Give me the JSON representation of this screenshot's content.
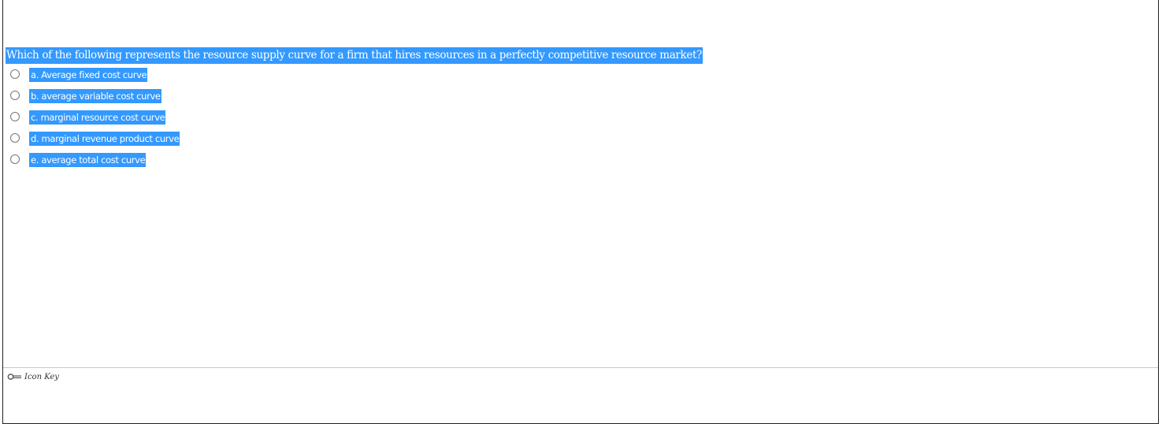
{
  "question": {
    "text": "Which of the following represents the resource supply curve for a firm that hires resources in a perfectly competitive resource market?"
  },
  "options": [
    {
      "label": "a. Average fixed cost curve",
      "selected": false
    },
    {
      "label": "b. average variable cost curve",
      "selected": false
    },
    {
      "label": "c. marginal resource cost curve",
      "selected": false
    },
    {
      "label": "d. marginal revenue product curve",
      "selected": false
    },
    {
      "label": "e. average total cost curve",
      "selected": false
    }
  ],
  "footer": {
    "icon_key_label": "Icon Key",
    "icon": "key-icon"
  },
  "colors": {
    "selection_highlight": "#3399ff"
  }
}
